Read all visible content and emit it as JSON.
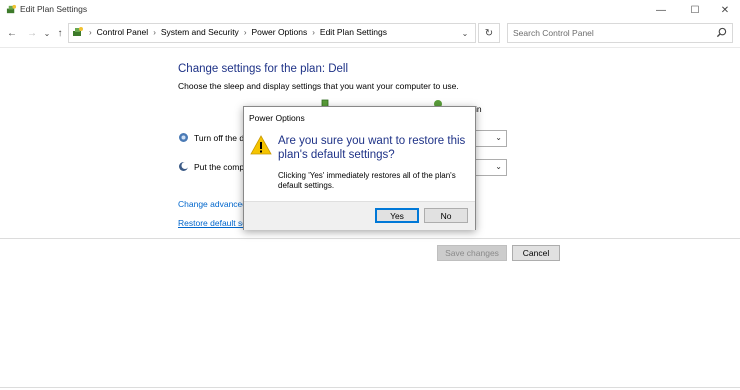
{
  "window": {
    "title": "Edit Plan Settings",
    "minimize_glyph": "—",
    "maximize_glyph": "☐",
    "close_glyph": "✕"
  },
  "nav": {
    "back_glyph": "←",
    "forward_glyph": "→",
    "recent_glyph": "⌄",
    "up_glyph": "↑",
    "refresh_glyph": "↻",
    "dropdown_glyph": "⌄",
    "separator_glyph": "›"
  },
  "breadcrumb": {
    "items": [
      "Control Panel",
      "System and Security",
      "Power Options",
      "Edit Plan Settings"
    ]
  },
  "search": {
    "placeholder": "Search Control Panel"
  },
  "main": {
    "title": "Change settings for the plan: Dell",
    "subtitle": "Choose the sleep and display settings that you want your computer to use.",
    "column_plugged_partial": "in",
    "row_display_label": "Turn off the di",
    "row_sleep_label": "Put the comp",
    "dropdown_glyph": "⌄",
    "advanced_link": "Change advanced",
    "restore_link": "Restore default set",
    "save_button": "Save changes",
    "cancel_button": "Cancel"
  },
  "dialog": {
    "title": "Power Options",
    "main_instruction": "Are you sure you want to restore this plan's default settings?",
    "detail": "Clicking 'Yes' immediately restores all of the plan's default settings.",
    "yes_button": "Yes",
    "no_button": "No"
  },
  "colors": {
    "heading_blue": "#1e3287",
    "link_blue": "#0066cc",
    "warning_yellow": "#f5c400",
    "focus_blue": "#0078d7"
  },
  "icons": {
    "app": "power-options-icon",
    "warning": "warning-icon",
    "search": "search-icon",
    "display": "display-icon",
    "sleep": "moon-icon",
    "battery": "battery-icon",
    "plug": "plug-icon"
  }
}
